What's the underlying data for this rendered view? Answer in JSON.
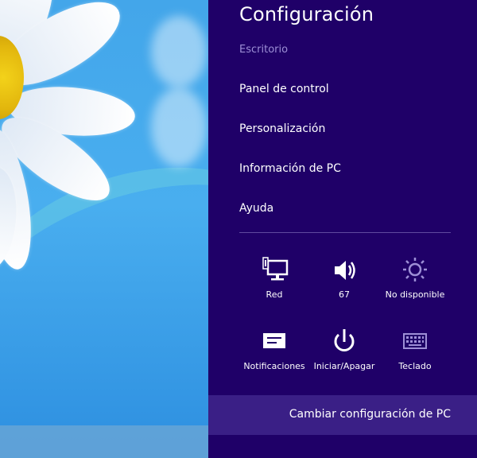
{
  "panel": {
    "title": "Configuración",
    "subtitle": "Escritorio",
    "menu_items": [
      {
        "label": "Panel de control"
      },
      {
        "label": "Personalización"
      },
      {
        "label": "Información de PC"
      },
      {
        "label": "Ayuda"
      }
    ]
  },
  "quick_settings": {
    "row1": [
      {
        "icon": "network-icon",
        "label": "Red"
      },
      {
        "icon": "volume-icon",
        "label": "67"
      },
      {
        "icon": "brightness-icon",
        "label": "No disponible"
      }
    ],
    "row2": [
      {
        "icon": "notifications-icon",
        "label": "Notificaciones"
      },
      {
        "icon": "power-icon",
        "label": "Iniciar/Apagar"
      },
      {
        "icon": "keyboard-icon",
        "label": "Teclado"
      }
    ]
  },
  "footer": {
    "change_settings": "Cambiar configuración de PC"
  },
  "colors": {
    "panel_bg": "#1f0068",
    "footer_bg": "#3a1f86",
    "subtitle": "#9d8fd6"
  }
}
